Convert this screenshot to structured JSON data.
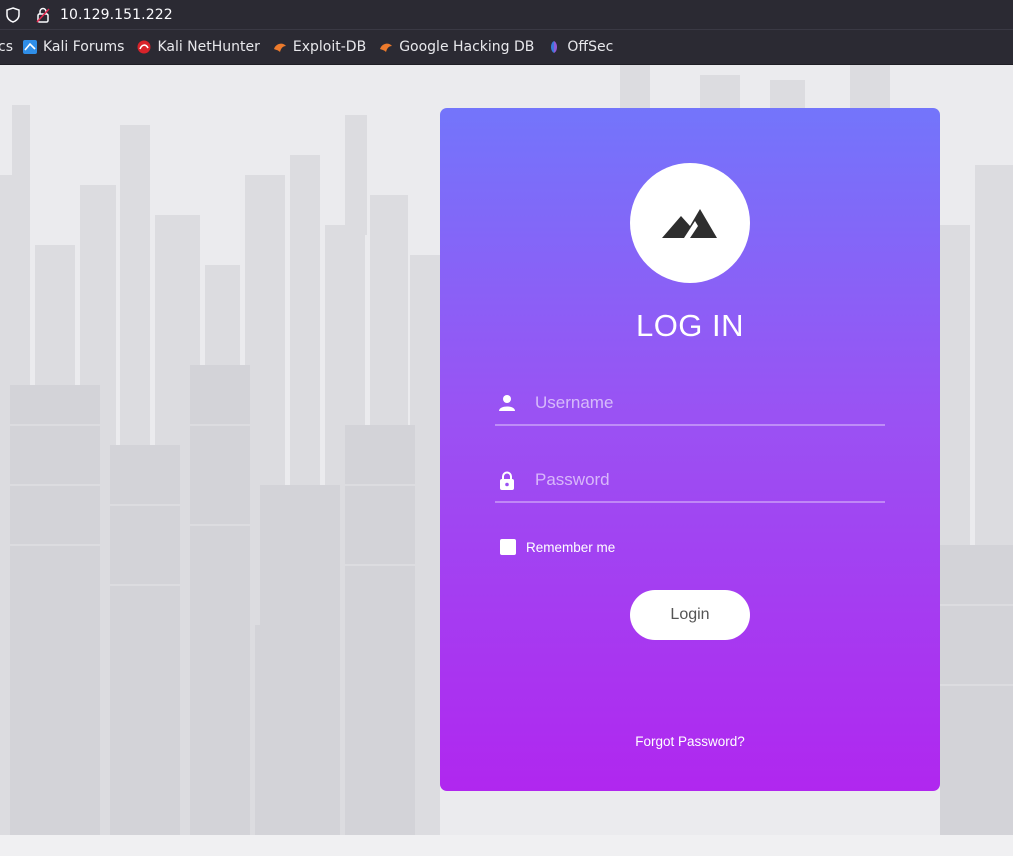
{
  "browser": {
    "url": "10.129.151.222",
    "bookmarks": [
      {
        "label": "cs",
        "icon": "bookmark-truncated-icon"
      },
      {
        "label": "Kali Forums",
        "icon": "kali-forums-icon"
      },
      {
        "label": "Kali NetHunter",
        "icon": "kali-nethunter-icon"
      },
      {
        "label": "Exploit-DB",
        "icon": "exploit-db-icon"
      },
      {
        "label": "Google Hacking DB",
        "icon": "google-hacking-db-icon"
      },
      {
        "label": "OffSec",
        "icon": "offsec-icon"
      }
    ]
  },
  "login": {
    "logo_icon": "mountain-icon",
    "title": "LOG IN",
    "username_placeholder": "Username",
    "password_placeholder": "Password",
    "remember_label": "Remember me",
    "login_button": "Login",
    "forgot_link": "Forgot Password?"
  },
  "colors": {
    "gradient_top": "#7375fb",
    "gradient_bottom": "#b027ef",
    "browser_chrome": "#2b2a33"
  }
}
